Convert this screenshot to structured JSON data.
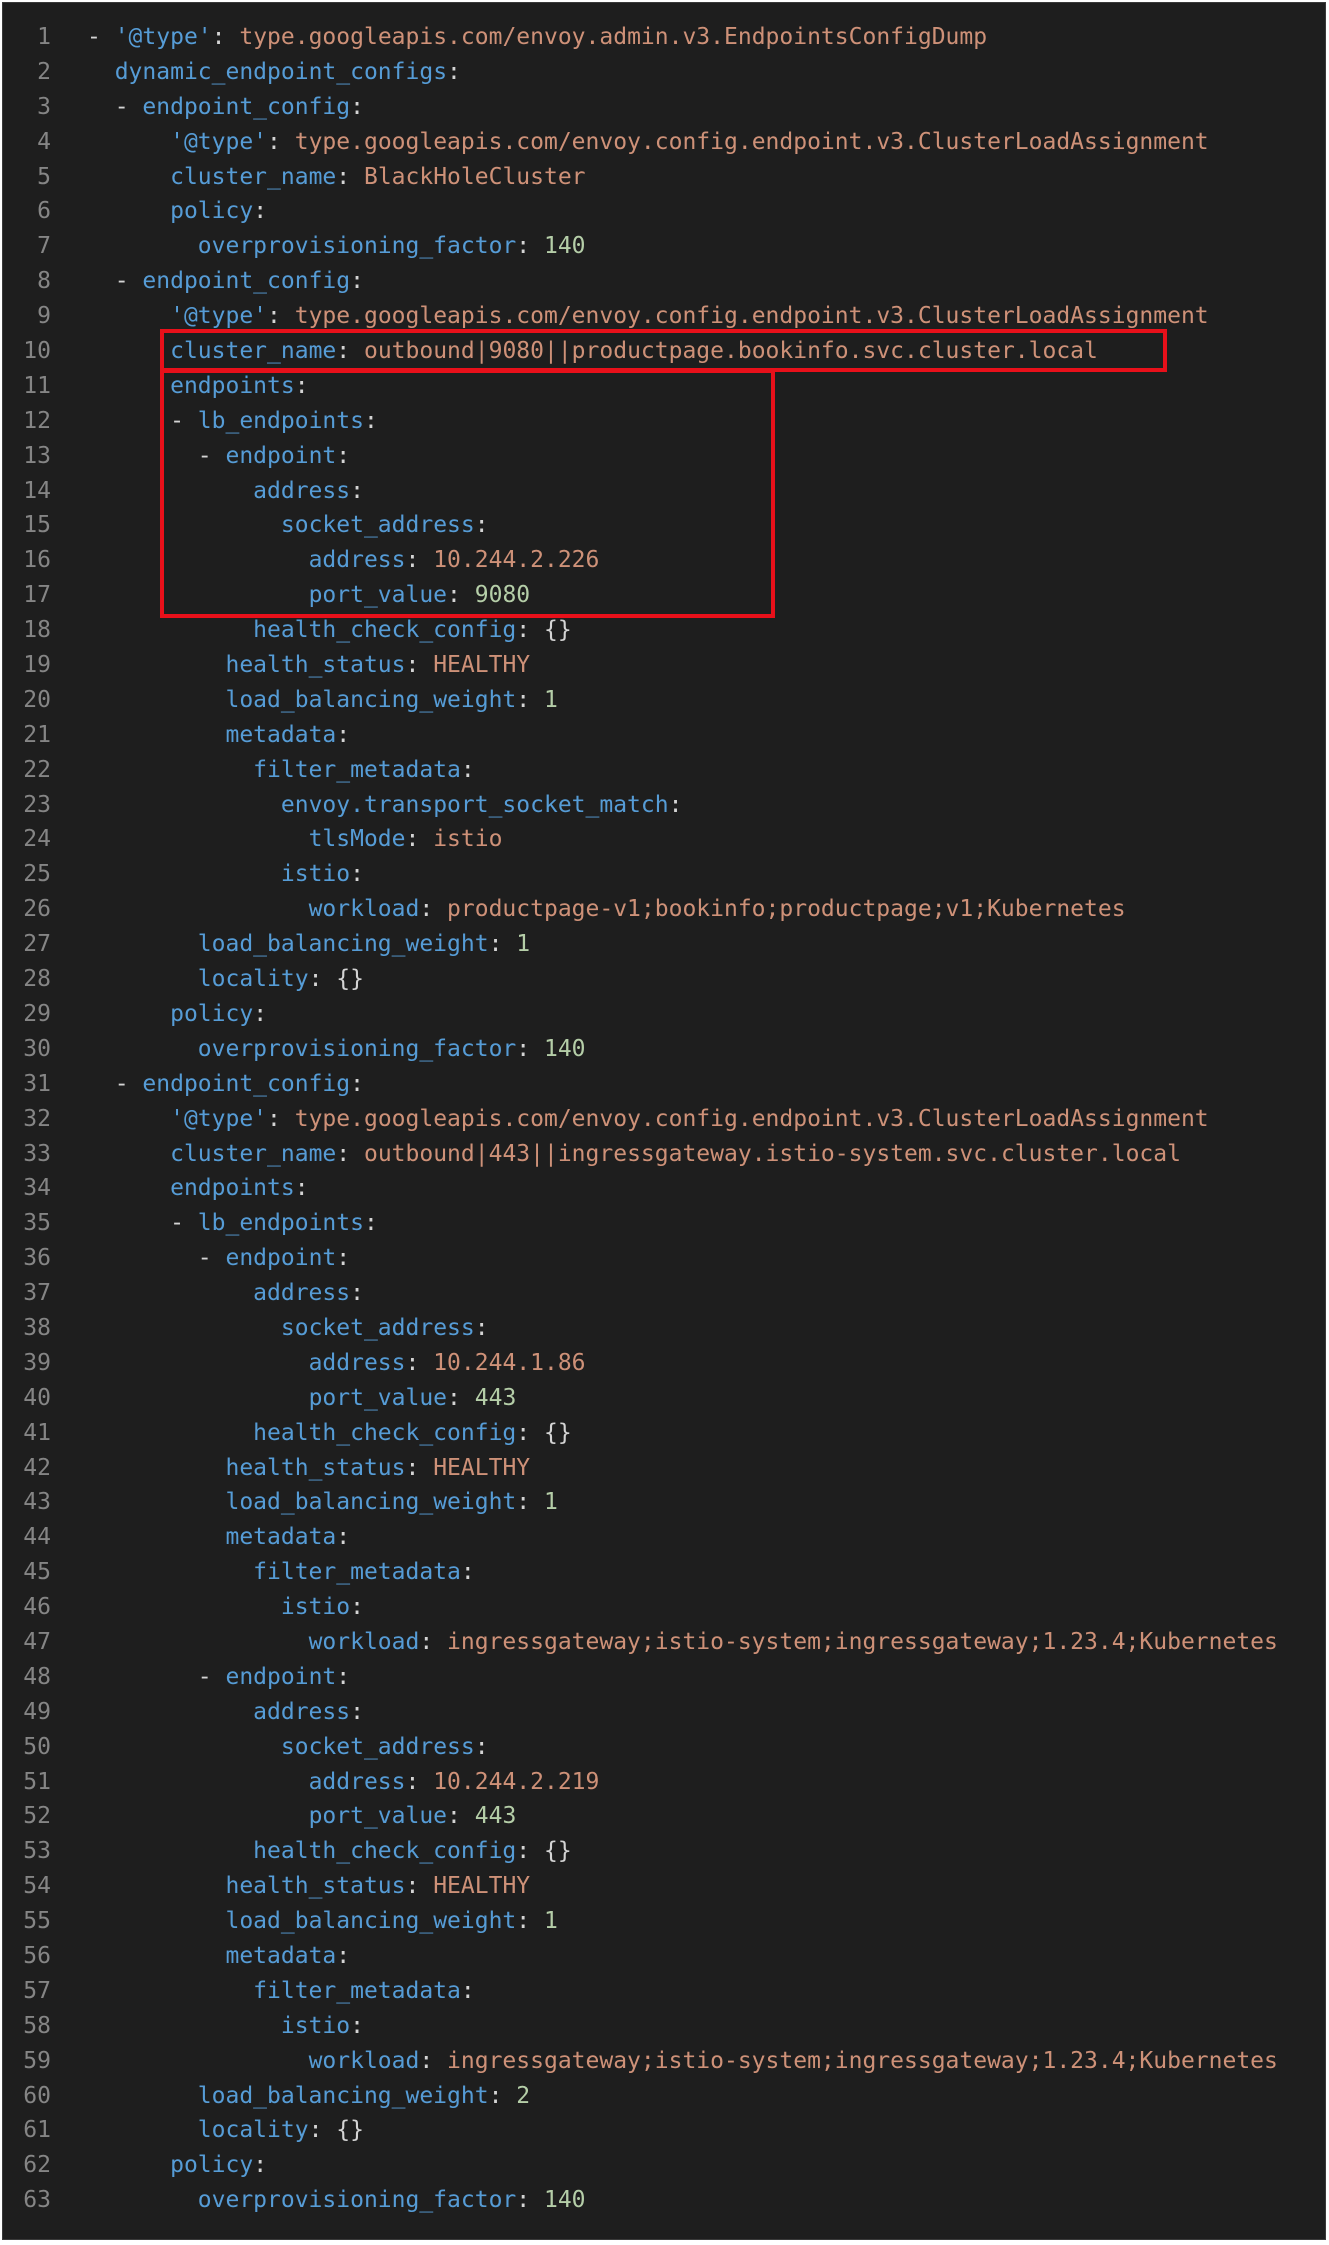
{
  "editor": {
    "lines": [
      {
        "n": "1",
        "indent": 0,
        "dash": true,
        "key": "'@type'",
        "sep": ": ",
        "val": "type.googleapis.com/envoy.admin.v3.EndpointsConfigDump",
        "vt": "s"
      },
      {
        "n": "2",
        "indent": 2,
        "dash": false,
        "key": "dynamic_endpoint_configs",
        "sep": ":",
        "val": "",
        "vt": ""
      },
      {
        "n": "3",
        "indent": 2,
        "dash": true,
        "key": "endpoint_config",
        "sep": ":",
        "val": "",
        "vt": ""
      },
      {
        "n": "4",
        "indent": 6,
        "dash": false,
        "key": "'@type'",
        "sep": ": ",
        "val": "type.googleapis.com/envoy.config.endpoint.v3.ClusterLoadAssignment",
        "vt": "s"
      },
      {
        "n": "5",
        "indent": 6,
        "dash": false,
        "key": "cluster_name",
        "sep": ": ",
        "val": "BlackHoleCluster",
        "vt": "s"
      },
      {
        "n": "6",
        "indent": 6,
        "dash": false,
        "key": "policy",
        "sep": ":",
        "val": "",
        "vt": ""
      },
      {
        "n": "7",
        "indent": 8,
        "dash": false,
        "key": "overprovisioning_factor",
        "sep": ": ",
        "val": "140",
        "vt": "n"
      },
      {
        "n": "8",
        "indent": 2,
        "dash": true,
        "key": "endpoint_config",
        "sep": ":",
        "val": "",
        "vt": ""
      },
      {
        "n": "9",
        "indent": 6,
        "dash": false,
        "key": "'@type'",
        "sep": ": ",
        "val": "type.googleapis.com/envoy.config.endpoint.v3.ClusterLoadAssignment",
        "vt": "s"
      },
      {
        "n": "10",
        "indent": 6,
        "dash": false,
        "key": "cluster_name",
        "sep": ": ",
        "val": "outbound|9080||productpage.bookinfo.svc.cluster.local",
        "vt": "s"
      },
      {
        "n": "11",
        "indent": 6,
        "dash": false,
        "key": "endpoints",
        "sep": ":",
        "val": "",
        "vt": ""
      },
      {
        "n": "12",
        "indent": 6,
        "dash": true,
        "key": "lb_endpoints",
        "sep": ":",
        "val": "",
        "vt": ""
      },
      {
        "n": "13",
        "indent": 8,
        "dash": true,
        "key": "endpoint",
        "sep": ":",
        "val": "",
        "vt": ""
      },
      {
        "n": "14",
        "indent": 12,
        "dash": false,
        "key": "address",
        "sep": ":",
        "val": "",
        "vt": ""
      },
      {
        "n": "15",
        "indent": 14,
        "dash": false,
        "key": "socket_address",
        "sep": ":",
        "val": "",
        "vt": ""
      },
      {
        "n": "16",
        "indent": 16,
        "dash": false,
        "key": "address",
        "sep": ": ",
        "val": "10.244.2.226",
        "vt": "s"
      },
      {
        "n": "17",
        "indent": 16,
        "dash": false,
        "key": "port_value",
        "sep": ": ",
        "val": "9080",
        "vt": "n"
      },
      {
        "n": "18",
        "indent": 12,
        "dash": false,
        "key": "health_check_config",
        "sep": ": ",
        "val": "{}",
        "vt": "p"
      },
      {
        "n": "19",
        "indent": 10,
        "dash": false,
        "key": "health_status",
        "sep": ": ",
        "val": "HEALTHY",
        "vt": "s"
      },
      {
        "n": "20",
        "indent": 10,
        "dash": false,
        "key": "load_balancing_weight",
        "sep": ": ",
        "val": "1",
        "vt": "n"
      },
      {
        "n": "21",
        "indent": 10,
        "dash": false,
        "key": "metadata",
        "sep": ":",
        "val": "",
        "vt": ""
      },
      {
        "n": "22",
        "indent": 12,
        "dash": false,
        "key": "filter_metadata",
        "sep": ":",
        "val": "",
        "vt": ""
      },
      {
        "n": "23",
        "indent": 14,
        "dash": false,
        "key": "envoy.transport_socket_match",
        "sep": ":",
        "val": "",
        "vt": ""
      },
      {
        "n": "24",
        "indent": 16,
        "dash": false,
        "key": "tlsMode",
        "sep": ": ",
        "val": "istio",
        "vt": "s"
      },
      {
        "n": "25",
        "indent": 14,
        "dash": false,
        "key": "istio",
        "sep": ":",
        "val": "",
        "vt": ""
      },
      {
        "n": "26",
        "indent": 16,
        "dash": false,
        "key": "workload",
        "sep": ": ",
        "val": "productpage-v1;bookinfo;productpage;v1;Kubernetes",
        "vt": "s"
      },
      {
        "n": "27",
        "indent": 8,
        "dash": false,
        "key": "load_balancing_weight",
        "sep": ": ",
        "val": "1",
        "vt": "n"
      },
      {
        "n": "28",
        "indent": 8,
        "dash": false,
        "key": "locality",
        "sep": ": ",
        "val": "{}",
        "vt": "p"
      },
      {
        "n": "29",
        "indent": 6,
        "dash": false,
        "key": "policy",
        "sep": ":",
        "val": "",
        "vt": ""
      },
      {
        "n": "30",
        "indent": 8,
        "dash": false,
        "key": "overprovisioning_factor",
        "sep": ": ",
        "val": "140",
        "vt": "n"
      },
      {
        "n": "31",
        "indent": 2,
        "dash": true,
        "key": "endpoint_config",
        "sep": ":",
        "val": "",
        "vt": ""
      },
      {
        "n": "32",
        "indent": 6,
        "dash": false,
        "key": "'@type'",
        "sep": ": ",
        "val": "type.googleapis.com/envoy.config.endpoint.v3.ClusterLoadAssignment",
        "vt": "s"
      },
      {
        "n": "33",
        "indent": 6,
        "dash": false,
        "key": "cluster_name",
        "sep": ": ",
        "val": "outbound|443||ingressgateway.istio-system.svc.cluster.local",
        "vt": "s"
      },
      {
        "n": "34",
        "indent": 6,
        "dash": false,
        "key": "endpoints",
        "sep": ":",
        "val": "",
        "vt": ""
      },
      {
        "n": "35",
        "indent": 6,
        "dash": true,
        "key": "lb_endpoints",
        "sep": ":",
        "val": "",
        "vt": ""
      },
      {
        "n": "36",
        "indent": 8,
        "dash": true,
        "key": "endpoint",
        "sep": ":",
        "val": "",
        "vt": ""
      },
      {
        "n": "37",
        "indent": 12,
        "dash": false,
        "key": "address",
        "sep": ":",
        "val": "",
        "vt": ""
      },
      {
        "n": "38",
        "indent": 14,
        "dash": false,
        "key": "socket_address",
        "sep": ":",
        "val": "",
        "vt": ""
      },
      {
        "n": "39",
        "indent": 16,
        "dash": false,
        "key": "address",
        "sep": ": ",
        "val": "10.244.1.86",
        "vt": "s"
      },
      {
        "n": "40",
        "indent": 16,
        "dash": false,
        "key": "port_value",
        "sep": ": ",
        "val": "443",
        "vt": "n"
      },
      {
        "n": "41",
        "indent": 12,
        "dash": false,
        "key": "health_check_config",
        "sep": ": ",
        "val": "{}",
        "vt": "p"
      },
      {
        "n": "42",
        "indent": 10,
        "dash": false,
        "key": "health_status",
        "sep": ": ",
        "val": "HEALTHY",
        "vt": "s"
      },
      {
        "n": "43",
        "indent": 10,
        "dash": false,
        "key": "load_balancing_weight",
        "sep": ": ",
        "val": "1",
        "vt": "n"
      },
      {
        "n": "44",
        "indent": 10,
        "dash": false,
        "key": "metadata",
        "sep": ":",
        "val": "",
        "vt": ""
      },
      {
        "n": "45",
        "indent": 12,
        "dash": false,
        "key": "filter_metadata",
        "sep": ":",
        "val": "",
        "vt": ""
      },
      {
        "n": "46",
        "indent": 14,
        "dash": false,
        "key": "istio",
        "sep": ":",
        "val": "",
        "vt": ""
      },
      {
        "n": "47",
        "indent": 16,
        "dash": false,
        "key": "workload",
        "sep": ": ",
        "val": "ingressgateway;istio-system;ingressgateway;1.23.4;Kubernetes",
        "vt": "s"
      },
      {
        "n": "48",
        "indent": 8,
        "dash": true,
        "key": "endpoint",
        "sep": ":",
        "val": "",
        "vt": ""
      },
      {
        "n": "49",
        "indent": 12,
        "dash": false,
        "key": "address",
        "sep": ":",
        "val": "",
        "vt": ""
      },
      {
        "n": "50",
        "indent": 14,
        "dash": false,
        "key": "socket_address",
        "sep": ":",
        "val": "",
        "vt": ""
      },
      {
        "n": "51",
        "indent": 16,
        "dash": false,
        "key": "address",
        "sep": ": ",
        "val": "10.244.2.219",
        "vt": "s"
      },
      {
        "n": "52",
        "indent": 16,
        "dash": false,
        "key": "port_value",
        "sep": ": ",
        "val": "443",
        "vt": "n"
      },
      {
        "n": "53",
        "indent": 12,
        "dash": false,
        "key": "health_check_config",
        "sep": ": ",
        "val": "{}",
        "vt": "p"
      },
      {
        "n": "54",
        "indent": 10,
        "dash": false,
        "key": "health_status",
        "sep": ": ",
        "val": "HEALTHY",
        "vt": "s"
      },
      {
        "n": "55",
        "indent": 10,
        "dash": false,
        "key": "load_balancing_weight",
        "sep": ": ",
        "val": "1",
        "vt": "n"
      },
      {
        "n": "56",
        "indent": 10,
        "dash": false,
        "key": "metadata",
        "sep": ":",
        "val": "",
        "vt": ""
      },
      {
        "n": "57",
        "indent": 12,
        "dash": false,
        "key": "filter_metadata",
        "sep": ":",
        "val": "",
        "vt": ""
      },
      {
        "n": "58",
        "indent": 14,
        "dash": false,
        "key": "istio",
        "sep": ":",
        "val": "",
        "vt": ""
      },
      {
        "n": "59",
        "indent": 16,
        "dash": false,
        "key": "workload",
        "sep": ": ",
        "val": "ingressgateway;istio-system;ingressgateway;1.23.4;Kubernetes",
        "vt": "s"
      },
      {
        "n": "60",
        "indent": 8,
        "dash": false,
        "key": "load_balancing_weight",
        "sep": ": ",
        "val": "2",
        "vt": "n"
      },
      {
        "n": "61",
        "indent": 8,
        "dash": false,
        "key": "locality",
        "sep": ": ",
        "val": "{}",
        "vt": "p"
      },
      {
        "n": "62",
        "indent": 6,
        "dash": false,
        "key": "policy",
        "sep": ":",
        "val": "",
        "vt": ""
      },
      {
        "n": "63",
        "indent": 8,
        "dash": false,
        "key": "overprovisioning_factor",
        "sep": ": ",
        "val": "140",
        "vt": "n"
      }
    ]
  },
  "colors": {
    "background": "#1e1e1e",
    "line_number": "#858585",
    "key": "#569cd6",
    "string": "#ce9178",
    "number": "#b5cea8",
    "punctuation": "#d4d4d4",
    "highlight_box": "#e8101a"
  }
}
